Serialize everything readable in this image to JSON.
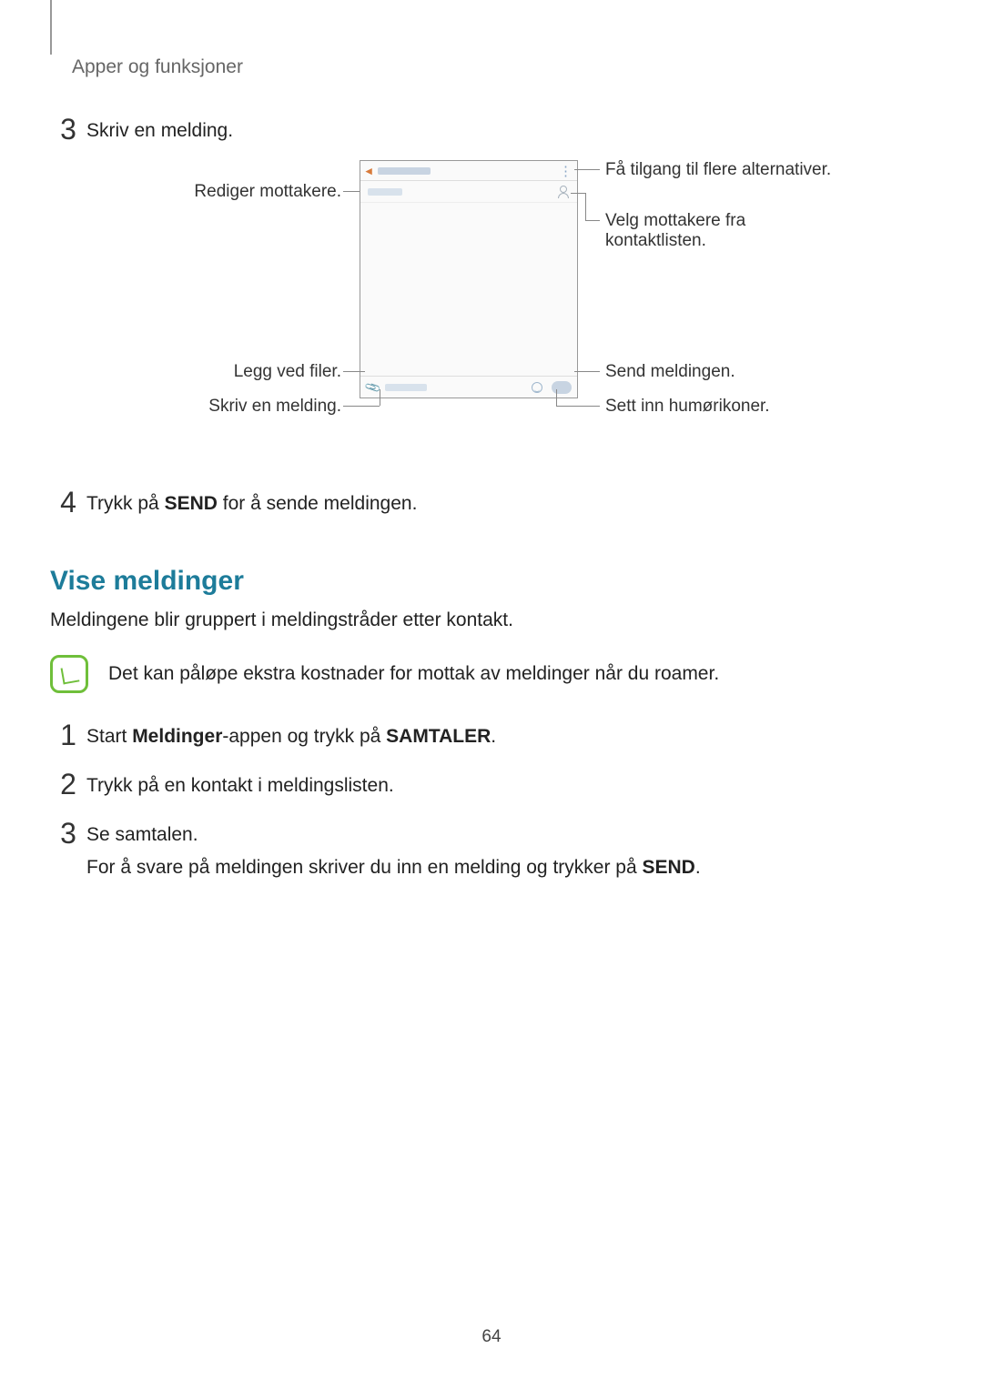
{
  "breadcrumb": "Apper og funksjoner",
  "step3": {
    "num": "3",
    "text": "Skriv en melding."
  },
  "diagram": {
    "left": {
      "edit_recipients": "Rediger mottakere.",
      "attach_files": "Legg ved filer.",
      "write_message": "Skriv en melding."
    },
    "right": {
      "more_options": "Få tilgang til flere alternativer.",
      "select_recipients": "Velg mottakere fra kontaktlisten.",
      "send_message": "Send meldingen.",
      "insert_emoticons": "Sett inn humørikoner."
    }
  },
  "step4": {
    "num": "4",
    "prefix": "Trykk på ",
    "bold": "SEND",
    "suffix": " for å sende meldingen."
  },
  "section_heading": "Vise meldinger",
  "section_para": "Meldingene blir gruppert i meldingstråder etter kontakt.",
  "note_text": "Det kan påløpe ekstra kostnader for mottak av meldinger når du roamer.",
  "vstep1": {
    "num": "1",
    "t1": "Start ",
    "b1": "Meldinger",
    "t2": "-appen og trykk på ",
    "b2": "SAMTALER",
    "t3": "."
  },
  "vstep2": {
    "num": "2",
    "text": "Trykk på en kontakt i meldingslisten."
  },
  "vstep3": {
    "num": "3",
    "text": "Se samtalen.",
    "sub_prefix": "For å svare på meldingen skriver du inn en melding og trykker på ",
    "sub_bold": "SEND",
    "sub_suffix": "."
  },
  "page_number": "64"
}
